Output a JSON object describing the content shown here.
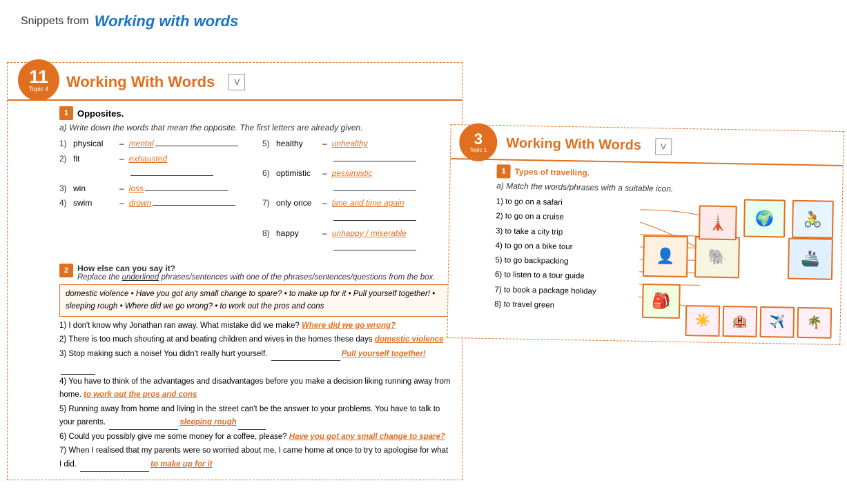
{
  "header": {
    "plain_text": "Snippets from",
    "styled_text": "Working with words"
  },
  "left_worksheet": {
    "unit_number": "11",
    "unit_sub": "Topic 4",
    "title": "Working With Words",
    "version": "V",
    "exercise1": {
      "number": "1",
      "title": "Opposites.",
      "instruction": "a) Write down the words that mean the opposite. The first letters are already given.",
      "items_left": [
        {
          "num": "1)",
          "word": "physical",
          "dash": "–",
          "answer": "mental"
        },
        {
          "num": "2)",
          "word": "fit",
          "dash": "–",
          "answer": "exhausted"
        },
        {
          "num": "3)",
          "word": "win",
          "dash": "–",
          "answer": "loss"
        },
        {
          "num": "4)",
          "word": "swim",
          "dash": "–",
          "answer": "drown"
        }
      ],
      "items_right": [
        {
          "num": "5)",
          "word": "healthy",
          "dash": "–",
          "answer": "unhealthy"
        },
        {
          "num": "6)",
          "word": "optimistic",
          "dash": "–",
          "answer": "pessimistic"
        },
        {
          "num": "7)",
          "word": "only once",
          "dash": "–",
          "answer": "time and time again"
        },
        {
          "num": "8)",
          "word": "happy",
          "dash": "–",
          "answer": "unhappy / miserable"
        }
      ]
    },
    "exercise2": {
      "number": "2",
      "title": "How else can you say it?",
      "instruction": "Replace the underlined phrases/sentences with one of the phrases/sentences/questions from the box.",
      "phrase_box": "domestic violence • Have you got any small change to spare? • to make up for it • Pull yourself together! • sleeping rough • Where did we go wrong? • to work out the pros and cons",
      "items": [
        {
          "num": "1)",
          "text": "I don't know why Jonathan ran away. What mistake did we make?",
          "answer": "Where did we go wrong?",
          "answer_inline": true
        },
        {
          "num": "2)",
          "text": "There is too much shouting at and beating children and wives in the homes these days",
          "answer": "domestic violence",
          "answer_inline": true
        },
        {
          "num": "3)",
          "text": "Stop making such a noise! You didn't really hurt yourself.",
          "answer": "Pull yourself together!",
          "answer_inline": true
        },
        {
          "num": "4)",
          "text": "You have to think of the advantages and disadvantages before you make a decision liking running away from home.",
          "answer": "to work out the pros and cons",
          "answer_inline": true
        },
        {
          "num": "5)",
          "text": "Running away from home and living in the street can't be the answer to your problems. You have to talk to your parents.",
          "answer": "sleeping rough",
          "answer_inline": true
        },
        {
          "num": "6)",
          "text": "Could you possibly give me some money for a coffee, please?",
          "answer": "Have you got any small change to spare?",
          "answer_inline": true
        },
        {
          "num": "7)",
          "text": "When I realised that my parents were so worried about me, I came home at once to try to apologise for what I did.",
          "answer": "to make up for it",
          "answer_inline": true
        }
      ]
    }
  },
  "right_worksheet": {
    "unit_number": "3",
    "unit_sub": "Topic 1",
    "title": "Working With Words",
    "version": "V",
    "exercise1": {
      "number": "1",
      "title": "Types of travelling.",
      "instruction": "a) Match the words/phrases with a suitable icon.",
      "items": [
        {
          "num": "1)",
          "text": "to go on a safari"
        },
        {
          "num": "2)",
          "text": "to go on a cruise"
        },
        {
          "num": "3)",
          "text": "to take a city trip"
        },
        {
          "num": "4)",
          "text": "to go on a bike tour"
        },
        {
          "num": "5)",
          "text": "to go backpacking"
        },
        {
          "num": "6)",
          "text": "to listen to a tour guide"
        },
        {
          "num": "7)",
          "text": "to book a package holiday"
        },
        {
          "num": "8)",
          "text": "to travel green"
        }
      ]
    }
  }
}
